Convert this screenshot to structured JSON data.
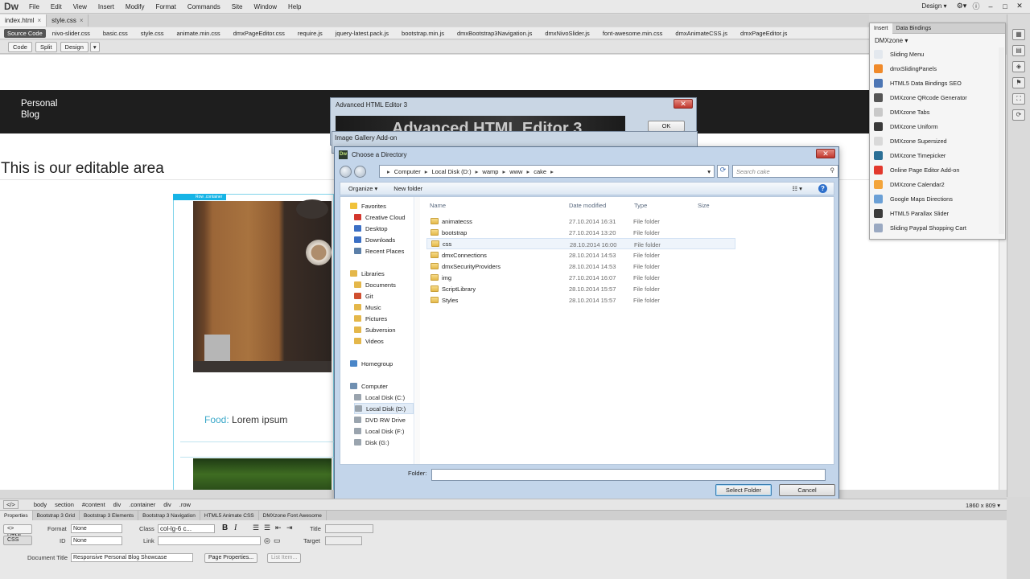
{
  "app": {
    "logo": "Dw",
    "menu": [
      "File",
      "Edit",
      "View",
      "Insert",
      "Modify",
      "Format",
      "Commands",
      "Site",
      "Window",
      "Help"
    ],
    "workspace": "Design ▾",
    "window_controls": [
      "⚙▾",
      "ⓘ",
      "–",
      "□",
      "✕"
    ]
  },
  "doc_tabs": [
    {
      "label": "index.html",
      "close": "×"
    },
    {
      "label": "style.css",
      "close": "×"
    }
  ],
  "related_files": {
    "source_label": "Source Code",
    "files": [
      "nivo-slider.css",
      "basic.css",
      "style.css",
      "animate.min.css",
      "dmxPageEditor.css",
      "require.js",
      "jquery-latest.pack.js",
      "bootstrap.min.js",
      "dmxBootstrap3Navigation.js",
      "dmxNivoSlider.js",
      "font-awesome.min.css",
      "dmxAnimateCSS.js",
      "dmxPageEditor.js"
    ]
  },
  "view_buttons": {
    "code": "Code",
    "split": "Split",
    "design": "Design",
    "arrow": "▾"
  },
  "canvas": {
    "logo_line1": "Personal",
    "logo_line2": "Blog",
    "heading": "This is our editable area",
    "row_tag": "Row .container",
    "food_label": "Food:",
    "food_text": " Lorem ipsum"
  },
  "insert_panel": {
    "tabs": [
      "Insert",
      "Data Bindings"
    ],
    "category": "DMXzone ▾",
    "items": [
      {
        "label": "Sliding Menu",
        "color": "#e3e8ee"
      },
      {
        "label": "dmxSlidingPanels",
        "color": "#f08a2a"
      },
      {
        "label": "HTML5 Data Bindings SEO",
        "color": "#4d76b4"
      },
      {
        "label": "DMXzone QRcode Generator",
        "color": "#555555"
      },
      {
        "label": "DMXzone Tabs",
        "color": "#c9c9c9"
      },
      {
        "label": "DMXzone Uniform",
        "color": "#3a3a3a"
      },
      {
        "label": "DMXzone Supersized",
        "color": "#d9d9d9"
      },
      {
        "label": "DMXzone Timepicker",
        "color": "#2b6f96"
      },
      {
        "label": "Online Page Editor Add-on",
        "color": "#e2382d"
      },
      {
        "label": "DMXzone Calendar2",
        "color": "#f3a43a"
      },
      {
        "label": "Google Maps Directions",
        "color": "#6ba0d6"
      },
      {
        "label": "HTML5 Parallax Slider",
        "color": "#3c3c3c"
      },
      {
        "label": "Sliding Paypal Shopping Cart",
        "color": "#9aa9c2"
      }
    ]
  },
  "right_toolbar": [
    "▦",
    "▤",
    "◈",
    "⚑",
    "⛶",
    "⟳"
  ],
  "status": {
    "code_btn": "</>",
    "tags": [
      "body",
      "section",
      "#content",
      "div",
      ".container",
      "div",
      ".row"
    ],
    "size": "1860 x 809 ▾"
  },
  "props": {
    "tabs": [
      "Properties",
      "Bootstrap 3 Grid",
      "Bootstrap 3 Elements",
      "Bootstrap 3 Navigation",
      "HTML5 Animate CSS",
      "DMXzone Font Awesome"
    ],
    "html_btn": "<> HTML",
    "css_btn": "CSS",
    "format_label": "Format",
    "format_value": "None",
    "id_label": "ID",
    "id_value": "None",
    "class_label": "Class",
    "class_value": "col-lg-6 c...",
    "link_label": "Link",
    "title_label": "Title",
    "target_label": "Target",
    "doc_title_label": "Document Title",
    "doc_title_value": "Responsive Personal Blog Showcase",
    "page_props_btn": "Page Properties...",
    "list_item_btn": "List Item..."
  },
  "ahe_dialog": {
    "title": "Advanced HTML Editor 3",
    "banner": "Advanced HTML Editor 3",
    "ok": "OK",
    "close": "✕"
  },
  "igal_dialog": {
    "title": "Image Gallery Add-on"
  },
  "dir_dialog": {
    "title": "Choose a Directory",
    "dw_icon": "Dw",
    "close": "✕",
    "breadcrumb": [
      "Computer",
      "Local Disk (D:)",
      "wamp",
      "www",
      "cake"
    ],
    "search_placeholder": "Search cake",
    "organize": "Organize ▾",
    "new_folder": "New folder",
    "view_icon": "☷ ▾",
    "help": "?",
    "columns": {
      "name": "Name",
      "date": "Date modified",
      "type": "Type",
      "size": "Size"
    },
    "nav": [
      {
        "label": "Favorites",
        "group": true
      },
      {
        "label": "Creative Cloud"
      },
      {
        "label": "Desktop"
      },
      {
        "label": "Downloads"
      },
      {
        "label": "Recent Places"
      },
      {
        "label": "Libraries",
        "group": true
      },
      {
        "label": "Documents"
      },
      {
        "label": "Git"
      },
      {
        "label": "Music"
      },
      {
        "label": "Pictures"
      },
      {
        "label": "Subversion"
      },
      {
        "label": "Videos"
      },
      {
        "label": "Homegroup",
        "group": true
      },
      {
        "label": "Computer",
        "group": true
      },
      {
        "label": "Local Disk (C:)"
      },
      {
        "label": "Local Disk (D:)",
        "selected": true
      },
      {
        "label": "DVD RW Drive"
      },
      {
        "label": "Local Disk (F:)"
      },
      {
        "label": "Disk (G:)"
      }
    ],
    "files": [
      {
        "name": "animatecss",
        "date": "27.10.2014 16:31",
        "type": "File folder"
      },
      {
        "name": "bootstrap",
        "date": "27.10.2014 13:20",
        "type": "File folder"
      },
      {
        "name": "css",
        "date": "28.10.2014 16:00",
        "type": "File folder",
        "hover": true
      },
      {
        "name": "dmxConnections",
        "date": "28.10.2014 14:53",
        "type": "File folder"
      },
      {
        "name": "dmxSecurityProviders",
        "date": "28.10.2014 14:53",
        "type": "File folder"
      },
      {
        "name": "img",
        "date": "27.10.2014 16:07",
        "type": "File folder"
      },
      {
        "name": "ScriptLibrary",
        "date": "28.10.2014 15:57",
        "type": "File folder"
      },
      {
        "name": "Styles",
        "date": "28.10.2014 15:57",
        "type": "File folder"
      }
    ],
    "folder_label": "Folder:",
    "folder_value": "",
    "select_btn": "Select Folder",
    "cancel_btn": "Cancel"
  }
}
